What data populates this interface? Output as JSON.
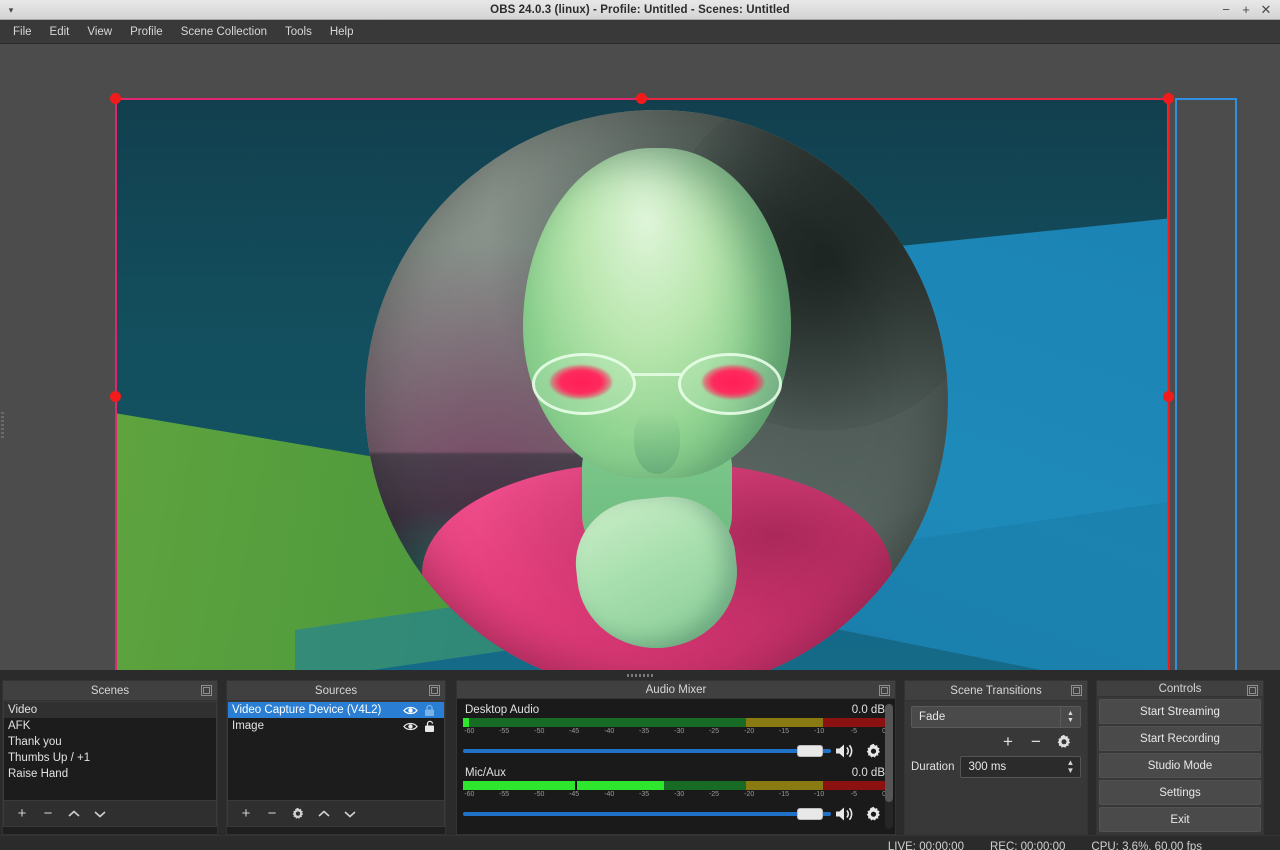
{
  "window": {
    "title": "OBS 24.0.3 (linux) - Profile: Untitled - Scenes: Untitled",
    "menu_arrow": "▾",
    "minimize": "−",
    "maximize": "+",
    "close": "✕"
  },
  "menubar": {
    "items": [
      {
        "label": "File"
      },
      {
        "label": "Edit"
      },
      {
        "label": "View"
      },
      {
        "label": "Profile"
      },
      {
        "label": "Scene Collection"
      },
      {
        "label": "Tools"
      },
      {
        "label": "Help"
      }
    ]
  },
  "preview": {
    "selection_color": "#e0266d",
    "handle_color": "#f21b1b",
    "canvas_bounds_color": "#2f8fe0"
  },
  "scenes": {
    "title": "Scenes",
    "items": [
      {
        "label": "Video",
        "state": "hovered"
      },
      {
        "label": "AFK",
        "state": "normal"
      },
      {
        "label": "Thank you",
        "state": "normal"
      },
      {
        "label": "Thumbs Up / +1",
        "state": "normal"
      },
      {
        "label": "Raise Hand",
        "state": "normal"
      }
    ],
    "toolbar": {
      "add": "+",
      "remove": "−",
      "move_up": "^",
      "move_down": "v"
    }
  },
  "sources": {
    "title": "Sources",
    "items": [
      {
        "label": "Video Capture Device (V4L2)",
        "state": "selected",
        "visible": true,
        "locked": true
      },
      {
        "label": "Image",
        "state": "normal",
        "visible": true,
        "locked": false
      }
    ],
    "toolbar": {
      "add": "+",
      "remove": "−",
      "properties": "gear-icon",
      "move_up": "^",
      "move_down": "v"
    }
  },
  "audio_mixer": {
    "title": "Audio Mixer",
    "scale_ticks": [
      "-60",
      "-55",
      "-50",
      "-45",
      "-40",
      "-35",
      "-30",
      "-25",
      "-20",
      "-15",
      "-10",
      "-5",
      "0"
    ],
    "tracks": [
      {
        "name": "Desktop Audio",
        "db": "0.0 dB",
        "level_percent": 1.5,
        "peak_percent": 0,
        "volume_percent": 100
      },
      {
        "name": "Mic/Aux",
        "db": "0.0 dB",
        "level_percent": 47.5,
        "peak_percent": 26.5,
        "volume_percent": 100
      }
    ]
  },
  "scene_transitions": {
    "title": "Scene Transitions",
    "transition": "Fade",
    "add": "+",
    "remove": "−",
    "properties": "gear-icon",
    "duration_label": "Duration",
    "duration_value": "300 ms"
  },
  "controls": {
    "title": "Controls",
    "buttons": [
      {
        "label": "Start Streaming"
      },
      {
        "label": "Start Recording"
      },
      {
        "label": "Studio Mode"
      },
      {
        "label": "Settings"
      },
      {
        "label": "Exit"
      }
    ]
  },
  "statusbar": {
    "live": "LIVE: 00:00:00",
    "rec": "REC: 00:00:00",
    "cpu": "CPU: 3.6%, 60.00 fps"
  }
}
